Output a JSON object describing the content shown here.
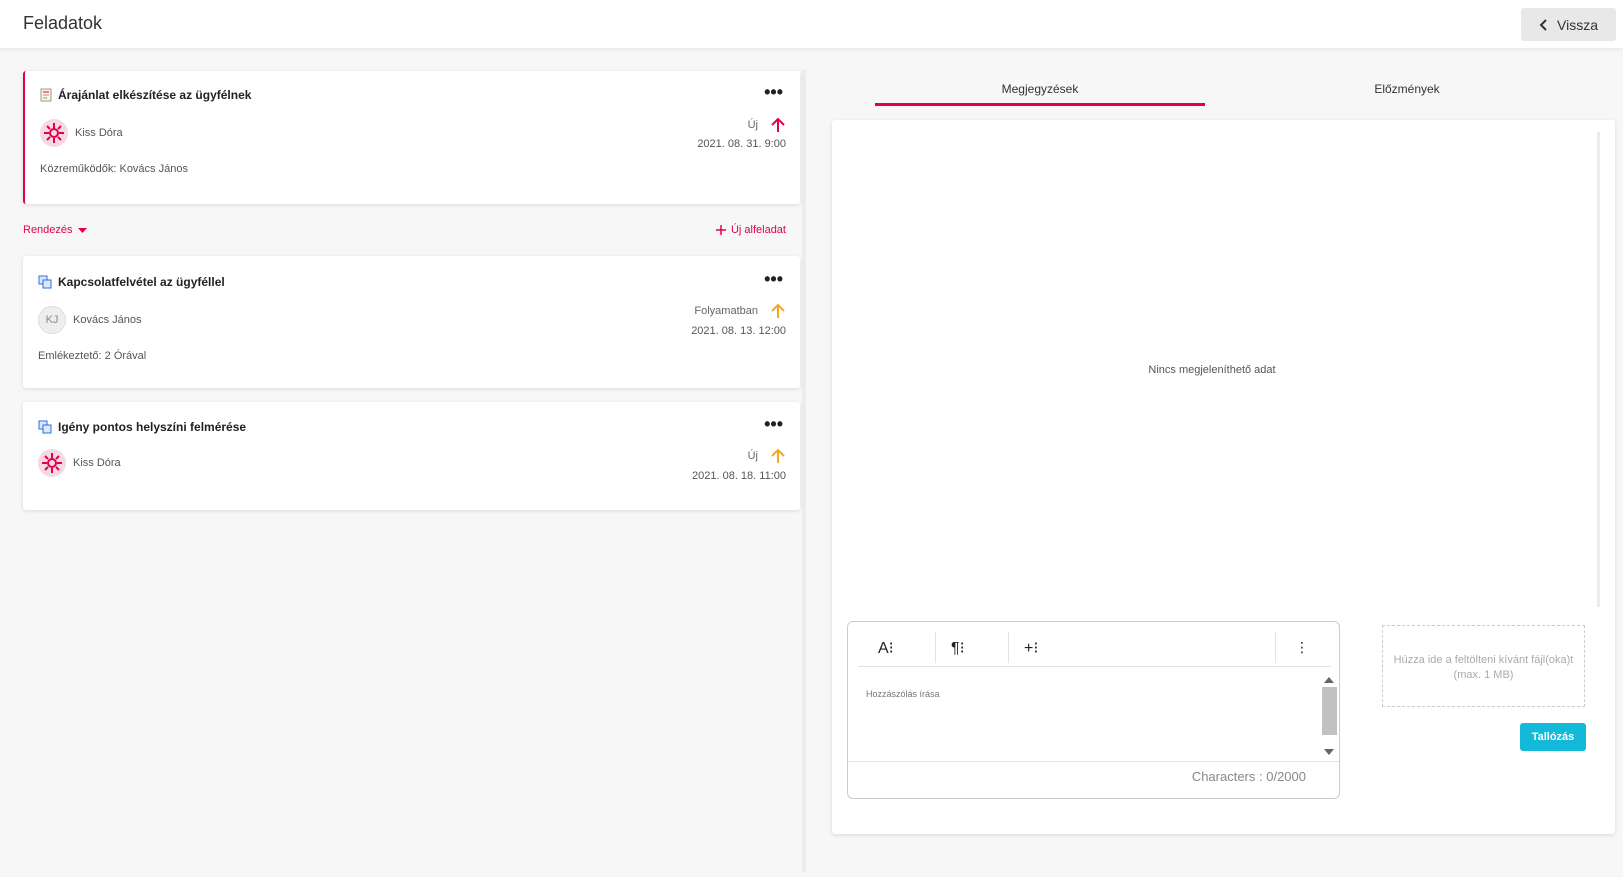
{
  "header": {
    "title": "Feladatok",
    "back_label": "Vissza"
  },
  "main_task": {
    "title": "Árajánlat elkészítése az ügyfélnek",
    "assignee": "Kiss Dóra",
    "status": "Új",
    "date": "2021. 08. 31. 9:00",
    "contributors": "Közreműködők: Kovács János",
    "priority_color": "#e0004d"
  },
  "toolbar": {
    "sort_label": "Rendezés",
    "new_subtask_label": "Új alfeladat"
  },
  "subtasks": [
    {
      "title": "Kapcsolatfelvétel az ügyféllel",
      "assignee": "Kovács János",
      "assignee_initials": "KJ",
      "status": "Folyamatban",
      "date": "2021. 08. 13. 12:00",
      "reminder": "Emlékeztető: 2 Órával",
      "priority_color": "#f5a623"
    },
    {
      "title": "Igény pontos helyszíni felmérése",
      "assignee": "Kiss Dóra",
      "status": "Új",
      "date": "2021. 08. 18. 11:00",
      "priority_color": "#f5a623"
    }
  ],
  "tabs": [
    {
      "label": "Megjegyzések",
      "active": true
    },
    {
      "label": "Előzmények",
      "active": false
    }
  ],
  "notes": {
    "empty_text": "Nincs megjeleníthető adat",
    "comment_placeholder": "Hozzászólás írása",
    "char_count": "Characters : 0/2000",
    "editor_tools": [
      "A⁝",
      "¶⁝",
      "+⁝"
    ]
  },
  "upload": {
    "drop_text": "Húzza ide a feltölteni kívánt fájl(oka)t",
    "max_size": "(max. 1 MB)",
    "browse_label": "Tallózás"
  },
  "colors": {
    "accent": "#e0004d",
    "browse": "#13b9d9"
  }
}
